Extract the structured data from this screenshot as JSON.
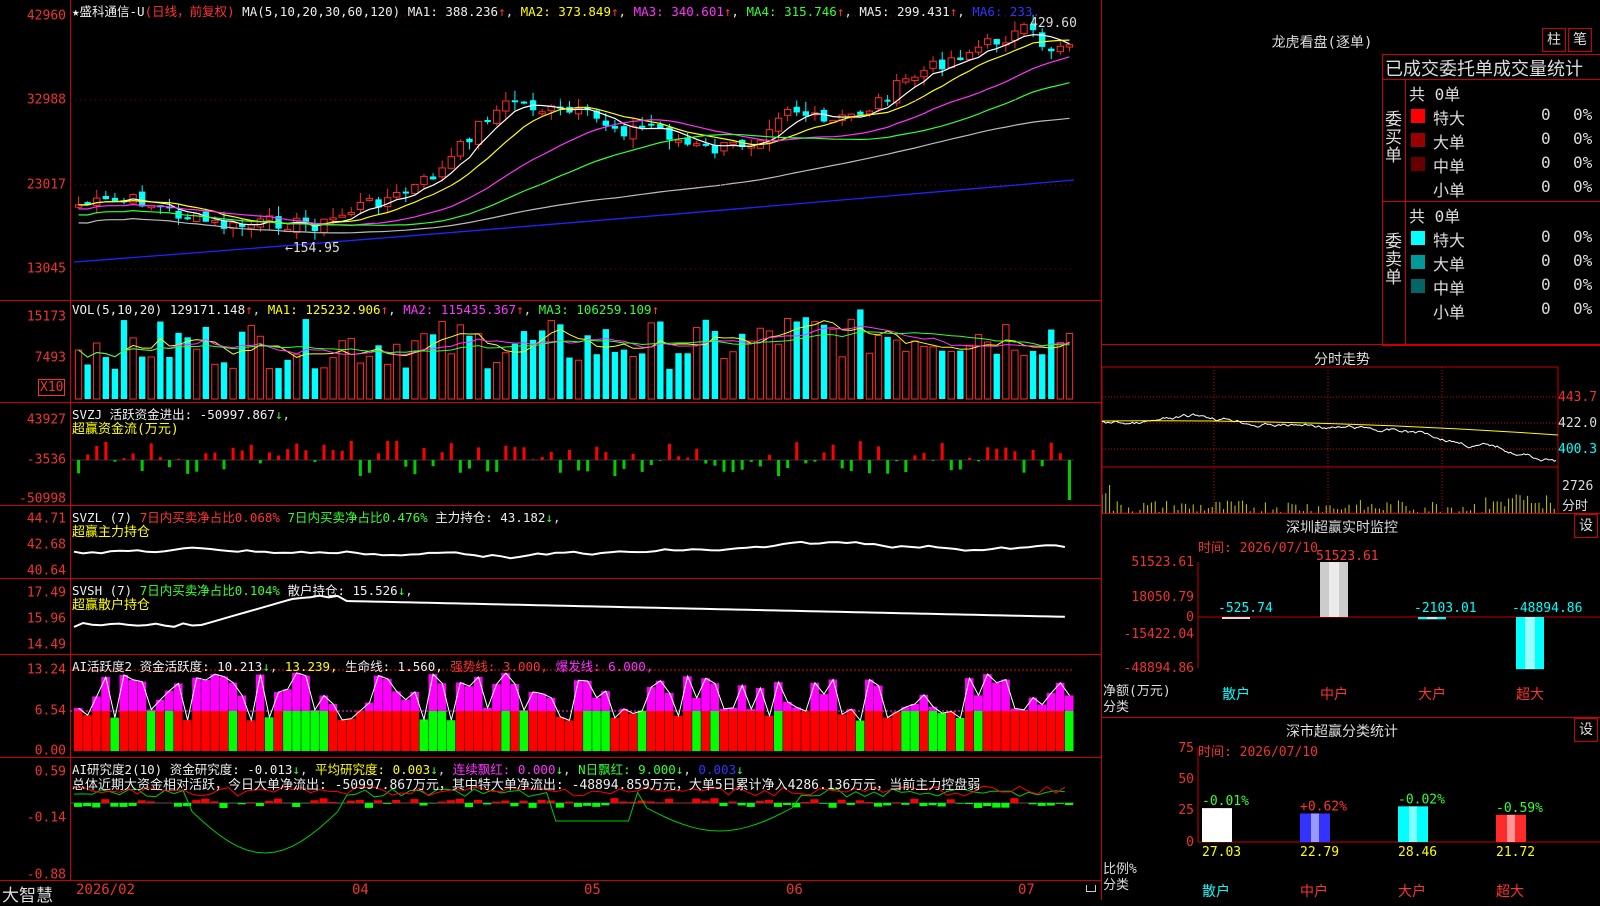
{
  "app": {
    "brand": "大智慧"
  },
  "kline": {
    "stock_title": "★盛科通信-U",
    "period": "(日线，前复权)",
    "ma_label": "MA(5,10,20,30,60,120)",
    "ma1": "MA1: 388.236",
    "ma2": "MA2: 373.849",
    "ma3": "MA3: 340.601",
    "ma4": "MA4: 315.746",
    "ma5": "MA5: 299.431",
    "ma6": "MA6: 233.",
    "y_labels": [
      "42960",
      "32988",
      "23017",
      "13045"
    ],
    "high_note": "429.60",
    "low_note": "←154.95",
    "colors": {
      "up": "#ff2a2a",
      "down": "#00ffff",
      "ma1": "#ffffff",
      "ma2": "#ffff00",
      "ma3": "#ff33ff",
      "ma4": "#33ff33",
      "ma5": "#bbbbbb",
      "ma6": "#2222ff"
    }
  },
  "vol": {
    "label": "VOL(5,10,20)",
    "value": "129171.148",
    "ma1": "MA1: 125232.906",
    "ma2": "MA2: 115435.367",
    "ma3": "MA3: 106259.109",
    "y_labels": [
      "15173",
      "7493"
    ],
    "unit": "X10"
  },
  "svzj": {
    "label": "SVZJ  活跃资金进出: -50997.867",
    "sub": "超赢资金流(万元)",
    "y_labels": [
      "43927",
      "-3536",
      "-50998"
    ]
  },
  "svzl": {
    "label": "SVZL (7)",
    "t1": "7日内买卖净占比0.068%",
    "t2": "7日内买卖净占比0.476%",
    "t3": "主力持仓: 43.182",
    "sub": "超赢主力持仓",
    "y_labels": [
      "44.71",
      "42.68",
      "40.64"
    ]
  },
  "svsh": {
    "label": "SVSH (7)",
    "t1": "7日内买卖净占比0.104%",
    "t2": "散户持仓: 15.526",
    "sub": "超赢散户持仓",
    "y_labels": [
      "17.49",
      "15.96",
      "14.49"
    ]
  },
  "ai1": {
    "label": "AI活跃度2 资金活跃度: 10.213",
    "t1": "13.239,",
    "t2": "生命线: 1.560,",
    "t3": "强势线: 3.000,",
    "t4": "爆发线: 6.000,",
    "y_labels": [
      "13.24",
      "6.54",
      "0.00"
    ]
  },
  "ai2": {
    "label": "AI研究度2(10) 资金研究度: -0.013",
    "t1": "平均研究度: 0.003",
    "t2": "连续飘红: 0.000",
    "t3": "N日飘红: 9.000",
    "t4": "0.003",
    "summary": "总体近期大资金相对活跃，今日大单净流出: -50997.867万元，其中特大单净流出: -48894.859万元，大单5日累计净入4286.136万元，当前主力控盘弱",
    "y_labels": [
      "0.59",
      "-0.14",
      "-0.88"
    ]
  },
  "xaxis": {
    "labels": [
      "2026/02",
      "04",
      "05",
      "06",
      "07"
    ]
  },
  "dragon": {
    "title": "龙虎看盘(逐单)",
    "btn1": "柱",
    "btn2": "笔",
    "table_title": "已成交委托单成交量统计",
    "buy": {
      "side": "委买单",
      "total": "共 0单",
      "rows": [
        {
          "name": "特大",
          "vol": "0",
          "pct": "0%",
          "color": "#ff0000"
        },
        {
          "name": "大单",
          "vol": "0",
          "pct": "0%",
          "color": "#990000"
        },
        {
          "name": "中单",
          "vol": "0",
          "pct": "0%",
          "color": "#660000"
        },
        {
          "name": "小单",
          "vol": "0",
          "pct": "0%",
          "color": "#000000"
        }
      ]
    },
    "sell": {
      "side": "委卖单",
      "total": "共 0单",
      "rows": [
        {
          "name": "特大",
          "vol": "0",
          "pct": "0%",
          "color": "#00ffff"
        },
        {
          "name": "大单",
          "vol": "0",
          "pct": "0%",
          "color": "#009999"
        },
        {
          "name": "中单",
          "vol": "0",
          "pct": "0%",
          "color": "#006666"
        },
        {
          "name": "小单",
          "vol": "0",
          "pct": "0%",
          "color": "#000000"
        }
      ]
    }
  },
  "intraday": {
    "title": "分时走势",
    "y_labels": [
      "443.7",
      "422.0",
      "400.3"
    ],
    "vol_label": "2726",
    "vol_unit": "分时"
  },
  "monitor": {
    "title": "深圳超赢实时监控",
    "btn": "设",
    "time": "时间: 2026/07/10",
    "y_labels": [
      "51523.61",
      "18050.79",
      "0",
      "-15422.04",
      "-48894.86"
    ],
    "y_unit": "净额(万元)",
    "x_unit": "分类",
    "categories": [
      "散户",
      "中户",
      "大户",
      "超大"
    ],
    "values": [
      -525.74,
      51523.61,
      -2103.01,
      -48894.86
    ],
    "value_labels": [
      "-525.74",
      "51523.61",
      "-2103.01",
      "-48894.86"
    ]
  },
  "classify": {
    "title": "深市超赢分类统计",
    "btn": "设",
    "time": "时间: 2026/07/10",
    "y_labels": [
      "75",
      "50",
      "25",
      "0"
    ],
    "y_unit": "比例%",
    "x_unit": "分类",
    "categories": [
      "散户",
      "中户",
      "大户",
      "超大"
    ],
    "values": [
      27.03,
      22.79,
      28.46,
      21.72
    ],
    "value_labels": [
      "27.03",
      "22.79",
      "28.46",
      "21.72"
    ],
    "change_labels": [
      "-0.01%",
      "+0.62%",
      "-0.02%",
      "-0.59%"
    ],
    "colors": [
      "#ffffff",
      "#3333ff",
      "#00ffff",
      "#ff2a2a"
    ]
  }
}
